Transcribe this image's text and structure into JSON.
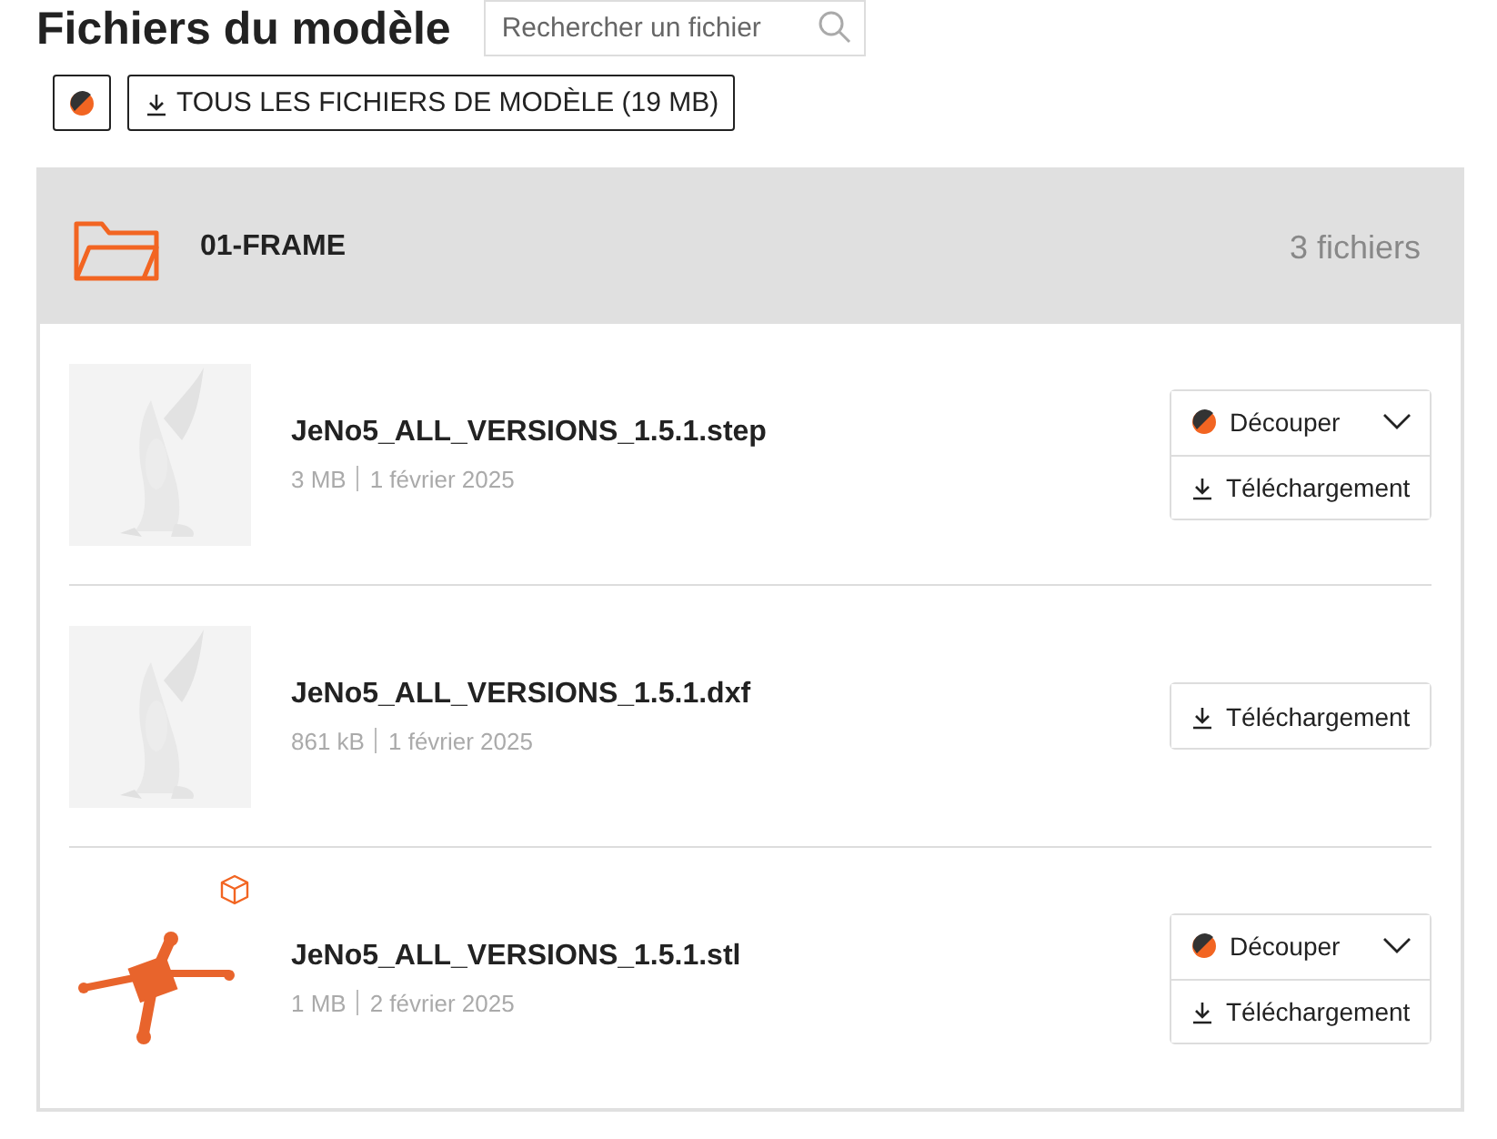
{
  "title": "Fichiers du modèle",
  "search": {
    "placeholder": "Rechercher un fichier"
  },
  "toolbar": {
    "download_all": "TOUS LES FICHIERS DE MODÈLE (19 MB)"
  },
  "folder": {
    "name": "01-FRAME",
    "count": "3 fichiers",
    "files": [
      {
        "kind": "cad",
        "model_3d": false,
        "name": "JeNo5_ALL_VERSIONS_1.5.1.step",
        "size": "3 MB",
        "date": "1 février 2025",
        "actions": [
          {
            "kind": "slice",
            "label": "Découper"
          },
          {
            "kind": "download",
            "label": "Téléchargement"
          }
        ]
      },
      {
        "kind": "cad",
        "model_3d": false,
        "name": "JeNo5_ALL_VERSIONS_1.5.1.dxf",
        "size": "861 kB",
        "date": "1 février 2025",
        "actions": [
          {
            "kind": "download",
            "label": "Téléchargement"
          }
        ]
      },
      {
        "kind": "mesh",
        "model_3d": true,
        "name": "JeNo5_ALL_VERSIONS_1.5.1.stl",
        "size": "1 MB",
        "date": "2 février 2025",
        "actions": [
          {
            "kind": "slice",
            "label": "Découper"
          },
          {
            "kind": "download",
            "label": "Téléchargement"
          }
        ]
      }
    ]
  }
}
